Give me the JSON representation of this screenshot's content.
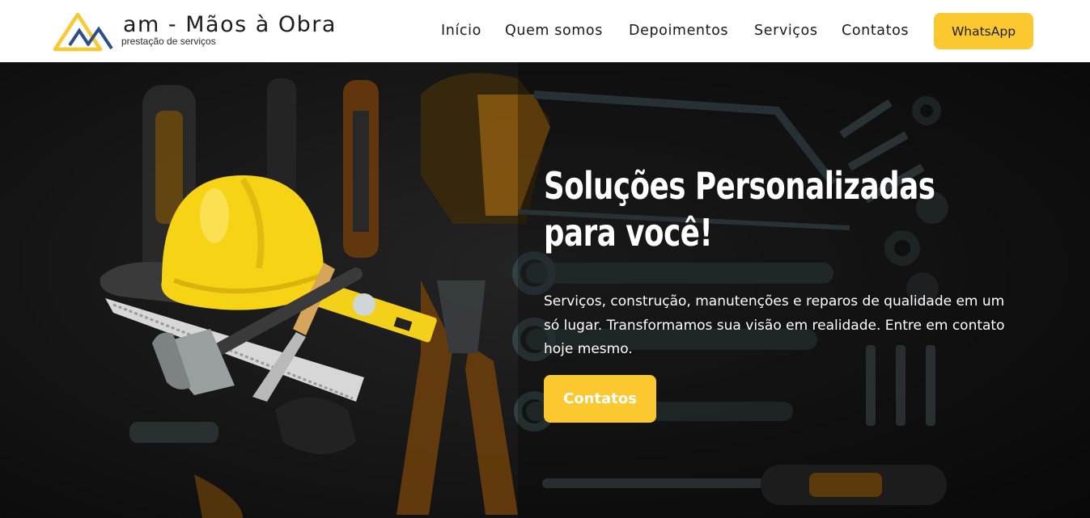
{
  "brand": {
    "title": "am - Mãos à Obra",
    "subtitle": "prestação de serviços",
    "colors": {
      "yellow": "#fcc82f",
      "navy": "#2d4e8a",
      "dark": "#151515"
    }
  },
  "nav": {
    "items": [
      {
        "label": "Início"
      },
      {
        "label": "Quem somos"
      },
      {
        "label": "Depoimentos"
      },
      {
        "label": "Serviços"
      },
      {
        "label": "Contatos"
      }
    ],
    "whatsapp_label": "WhatsApp"
  },
  "hero": {
    "title": "Soluções Personalizadas para você!",
    "text": "Serviços, construção, manutenções e reparos de qualidade em um só lugar. Transformamos sua visão em realidade. Entre em contato hoje mesmo.",
    "button_label": "Contatos",
    "image": {
      "subject": "hard-hat-and-tools-icon"
    }
  }
}
